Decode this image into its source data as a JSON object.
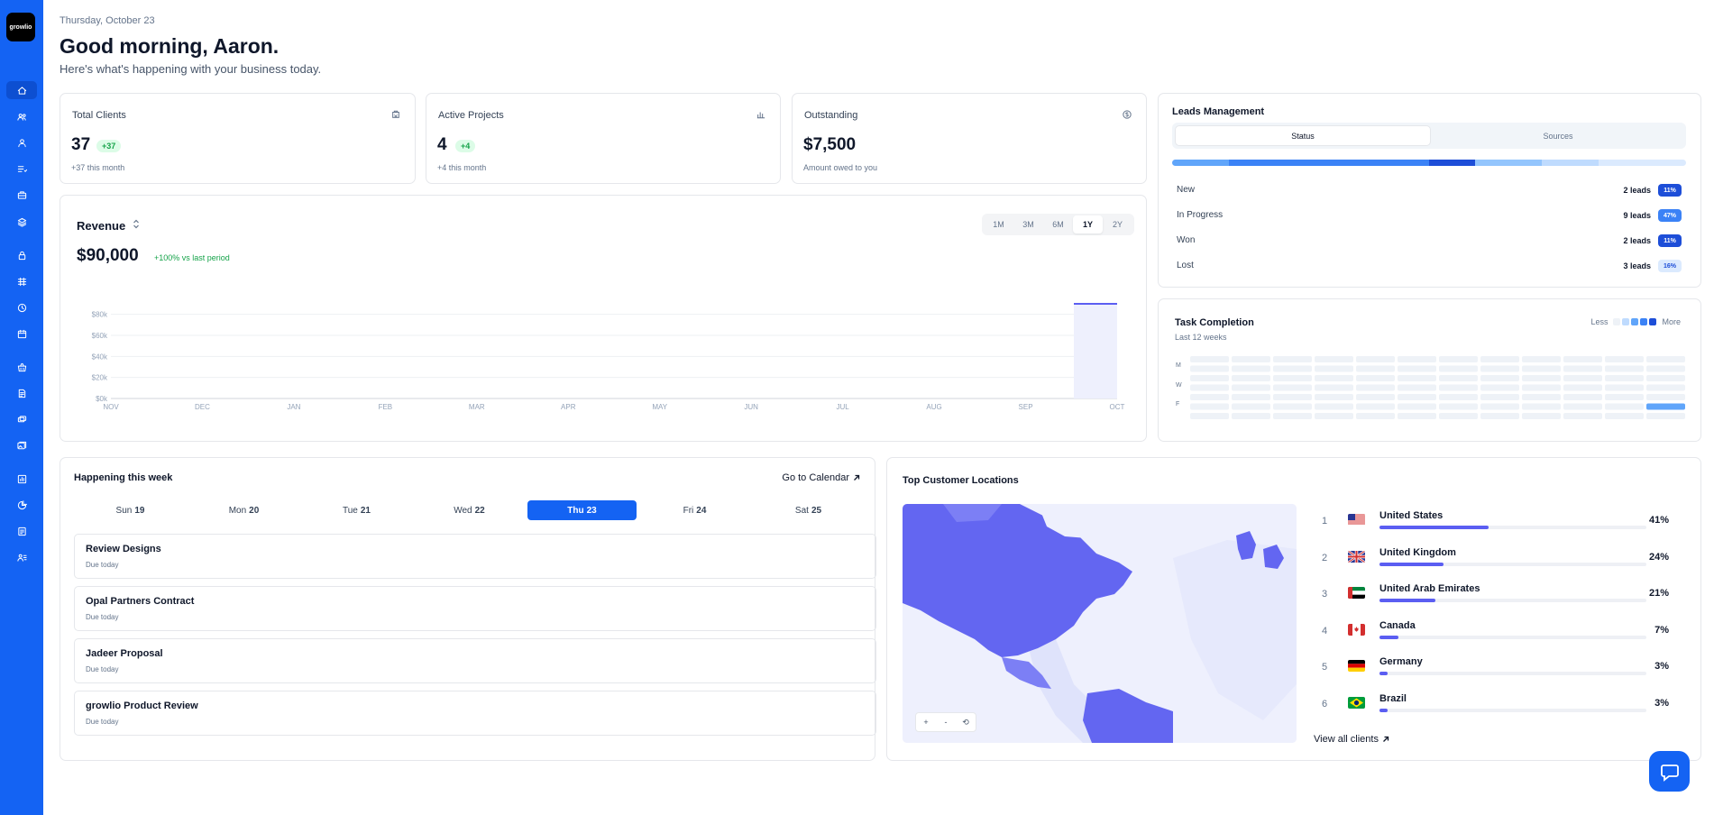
{
  "app": {
    "logo_text": "growlio",
    "accent": "#1463f3"
  },
  "sidebar": {
    "items": [
      {
        "name": "home-icon",
        "active": true
      },
      {
        "name": "clients-icon"
      },
      {
        "name": "user-icon"
      },
      {
        "name": "list-icon"
      },
      {
        "name": "briefcase-icon"
      },
      {
        "name": "layers-icon"
      },
      {
        "name": "lock-icon"
      },
      {
        "name": "grid-icon"
      },
      {
        "name": "clock-icon"
      },
      {
        "name": "calendar-icon"
      },
      {
        "name": "basket-icon"
      },
      {
        "name": "invoice-icon"
      },
      {
        "name": "cards-icon"
      },
      {
        "name": "gallery-icon"
      },
      {
        "name": "report-icon"
      },
      {
        "name": "pie-icon"
      },
      {
        "name": "doc-icon"
      },
      {
        "name": "team-icon"
      }
    ]
  },
  "header": {
    "date": "Thursday, October 23",
    "greeting": "Good morning, Aaron.",
    "subtitle": "Here's what's happening with your business today."
  },
  "stats": [
    {
      "title": "Total Clients",
      "value": "37",
      "badge": "+37",
      "sub": "+37 this month",
      "icon": "building-icon"
    },
    {
      "title": "Active Projects",
      "value": "4",
      "badge": "+4",
      "sub": "+4 this month",
      "icon": "bar-chart-icon"
    },
    {
      "title": "Outstanding",
      "value": "$7,500",
      "badge": "",
      "sub": "Amount owed to you",
      "icon": "dollar-icon"
    }
  ],
  "revenue": {
    "title": "Revenue",
    "sort_glyph": "⌃⌄",
    "total": "$90,000",
    "change": "+100% vs last period",
    "ranges": [
      "1M",
      "3M",
      "6M",
      "1Y",
      "2Y"
    ],
    "active_range": "1Y"
  },
  "chart_data": {
    "type": "area",
    "categories": [
      "NOV",
      "DEC",
      "JAN",
      "FEB",
      "MAR",
      "APR",
      "MAY",
      "JUN",
      "JUL",
      "AUG",
      "SEP",
      "OCT"
    ],
    "values": [
      0,
      0,
      0,
      0,
      0,
      0,
      0,
      0,
      0,
      0,
      0,
      90000
    ],
    "yticks": [
      "$0k",
      "$20k",
      "$40k",
      "$60k",
      "$80k"
    ],
    "ylim": [
      0,
      90000
    ],
    "color": "#5b5ef2",
    "grid": true
  },
  "leads": {
    "title": "Leads Management",
    "tabs": [
      "Status",
      "Sources"
    ],
    "rows": [
      {
        "label": "New",
        "count": "2 leads",
        "pct": "11%",
        "color": "#1d4ed8",
        "frac": 0.11
      },
      {
        "label": "In Progress",
        "count": "9 leads",
        "pct": "47%",
        "color": "#3b82f6",
        "frac": 0.47
      },
      {
        "label": "Won",
        "count": "2 leads",
        "pct": "11%",
        "color": "#1d4ed8",
        "frac": 0.11
      },
      {
        "label": "Lost",
        "count": "3 leads",
        "pct": "16%",
        "color": "#bfdbfe",
        "frac": 0.16
      }
    ]
  },
  "tasks_heatmap": {
    "title": "Task Completion",
    "subtitle": "Last 12 weeks",
    "legend_less": "Less",
    "legend_more": "More",
    "legend_colors": [
      "#eef2f7",
      "#bfdbfe",
      "#60a5fa",
      "#3b82f6",
      "#1d4ed8"
    ],
    "day_labels": [
      "M",
      "W",
      "F"
    ]
  },
  "week": {
    "title": "Happening this week",
    "calendar_link": "Go to Calendar",
    "days": [
      {
        "name": "Sun",
        "num": "19"
      },
      {
        "name": "Mon",
        "num": "20"
      },
      {
        "name": "Tue",
        "num": "21"
      },
      {
        "name": "Wed",
        "num": "22"
      },
      {
        "name": "Thu",
        "num": "23",
        "active": true
      },
      {
        "name": "Fri",
        "num": "24"
      },
      {
        "name": "Sat",
        "num": "25"
      }
    ],
    "tasks": [
      {
        "name": "Review Designs",
        "due": "Due today"
      },
      {
        "name": "Opal Partners Contract",
        "due": "Due today"
      },
      {
        "name": "Jadeer Proposal",
        "due": "Due today"
      },
      {
        "name": "growlio Product Review",
        "due": "Due today"
      }
    ]
  },
  "locations": {
    "title": "Top Customer Locations",
    "map_controls": [
      "+",
      "-",
      "⟲"
    ],
    "rows": [
      {
        "rank": "1",
        "name": "United States",
        "pct": "41%",
        "frac": 0.41,
        "flag": "us"
      },
      {
        "rank": "2",
        "name": "United Kingdom",
        "pct": "24%",
        "frac": 0.24,
        "flag": "gb"
      },
      {
        "rank": "3",
        "name": "United Arab Emirates",
        "pct": "21%",
        "frac": 0.21,
        "flag": "ae"
      },
      {
        "rank": "4",
        "name": "Canada",
        "pct": "7%",
        "frac": 0.07,
        "flag": "ca"
      },
      {
        "rank": "5",
        "name": "Germany",
        "pct": "3%",
        "frac": 0.03,
        "flag": "de"
      },
      {
        "rank": "6",
        "name": "Brazil",
        "pct": "3%",
        "frac": 0.03,
        "flag": "br"
      }
    ],
    "view_all": "View all clients"
  }
}
